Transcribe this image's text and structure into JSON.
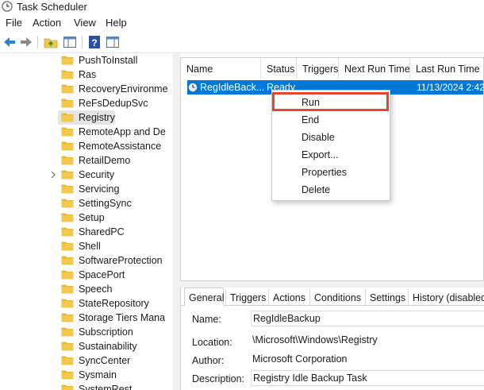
{
  "window": {
    "title": "Task Scheduler"
  },
  "menu": [
    "File",
    "Action",
    "View",
    "Help"
  ],
  "toolbar": [
    "back-icon",
    "forward-icon",
    "up-folder-icon",
    "show-hide-tree-icon",
    "help-icon",
    "action-pane-icon"
  ],
  "tree": {
    "items": [
      {
        "label": "PushToInstall",
        "expandable": false,
        "selected": false
      },
      {
        "label": "Ras",
        "expandable": false,
        "selected": false
      },
      {
        "label": "RecoveryEnvironme",
        "expandable": false,
        "selected": false
      },
      {
        "label": "ReFsDedupSvc",
        "expandable": false,
        "selected": false
      },
      {
        "label": "Registry",
        "expandable": false,
        "selected": true
      },
      {
        "label": "RemoteApp and De",
        "expandable": false,
        "selected": false
      },
      {
        "label": "RemoteAssistance",
        "expandable": false,
        "selected": false
      },
      {
        "label": "RetailDemo",
        "expandable": false,
        "selected": false
      },
      {
        "label": "Security",
        "expandable": true,
        "selected": false
      },
      {
        "label": "Servicing",
        "expandable": false,
        "selected": false
      },
      {
        "label": "SettingSync",
        "expandable": false,
        "selected": false
      },
      {
        "label": "Setup",
        "expandable": false,
        "selected": false
      },
      {
        "label": "SharedPC",
        "expandable": false,
        "selected": false
      },
      {
        "label": "Shell",
        "expandable": false,
        "selected": false
      },
      {
        "label": "SoftwareProtection",
        "expandable": false,
        "selected": false
      },
      {
        "label": "SpacePort",
        "expandable": false,
        "selected": false
      },
      {
        "label": "Speech",
        "expandable": false,
        "selected": false
      },
      {
        "label": "StateRepository",
        "expandable": false,
        "selected": false
      },
      {
        "label": "Storage Tiers Mana",
        "expandable": false,
        "selected": false
      },
      {
        "label": "Subscription",
        "expandable": false,
        "selected": false
      },
      {
        "label": "Sustainability",
        "expandable": false,
        "selected": false
      },
      {
        "label": "SyncCenter",
        "expandable": false,
        "selected": false
      },
      {
        "label": "Sysmain",
        "expandable": false,
        "selected": false
      },
      {
        "label": "SystemRest",
        "expandable": false,
        "selected": false
      }
    ]
  },
  "tasklist": {
    "columns": [
      "Name",
      "Status",
      "Triggers",
      "Next Run Time",
      "Last Run Time"
    ],
    "row": {
      "name": "RegIdleBack...",
      "status": "Ready",
      "triggers": "",
      "next_run": "",
      "last_run": "11/13/2024 2:42:"
    }
  },
  "context_menu": {
    "items": [
      "Run",
      "End",
      "Disable",
      "Export...",
      "Properties",
      "Delete"
    ],
    "highlighted": "Run",
    "highlight_color": "#e8452c"
  },
  "detail": {
    "tabs": [
      "General",
      "Triggers",
      "Actions",
      "Conditions",
      "Settings",
      "History (disabled)"
    ],
    "active_tab": "General",
    "fields": {
      "name_label": "Name:",
      "name_value": "RegIdleBackup",
      "location_label": "Location:",
      "location_value": "\\Microsoft\\Windows\\Registry",
      "author_label": "Author:",
      "author_value": "Microsoft Corporation",
      "description_label": "Description:",
      "description_value": "Registry Idle Backup Task"
    }
  },
  "colors": {
    "selection": "#0078d7",
    "folder": "#f3c84f",
    "accent_red": "#e8452c"
  }
}
